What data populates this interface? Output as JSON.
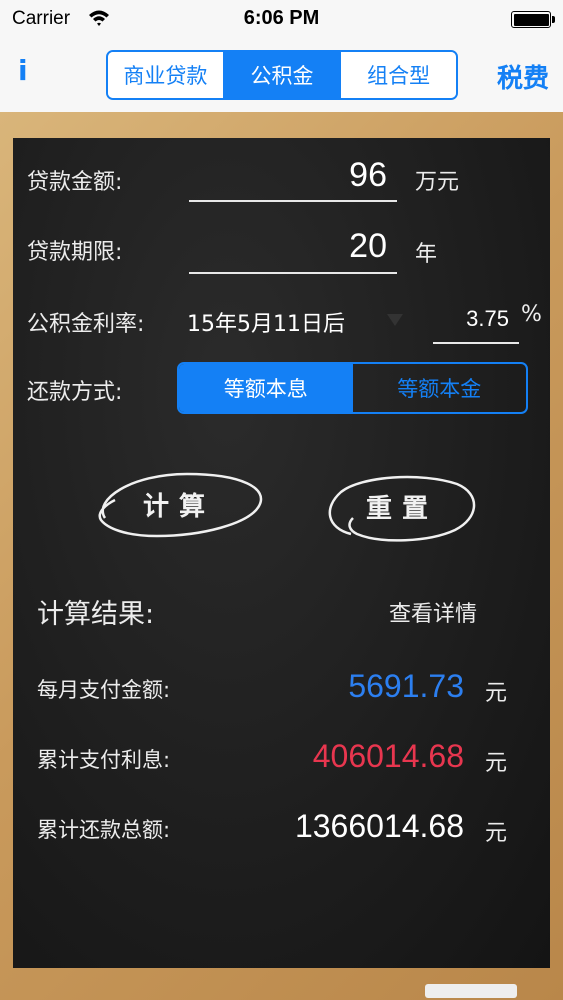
{
  "status_bar": {
    "carrier": "Carrier",
    "time": "6:06 PM"
  },
  "nav": {
    "info_label": "i",
    "segments": [
      {
        "label": "商业贷款",
        "active": false
      },
      {
        "label": "公积金",
        "active": true
      },
      {
        "label": "组合型",
        "active": false
      }
    ],
    "tax_label": "税费"
  },
  "form": {
    "amount": {
      "label": "贷款金额:",
      "value": "96",
      "unit": "万元"
    },
    "term": {
      "label": "贷款期限:",
      "value": "20",
      "unit": "年"
    },
    "rate": {
      "label": "公积金利率:",
      "selected": "15年5月11日后",
      "value": "3.75",
      "unit": "%"
    },
    "method": {
      "label": "还款方式:",
      "options": [
        "等额本息",
        "等额本金"
      ],
      "selected_index": 0
    }
  },
  "actions": {
    "calculate": "计算",
    "reset": "重置"
  },
  "result": {
    "title": "计算结果:",
    "detail_link": "查看详情",
    "rows": [
      {
        "label": "每月支付金额:",
        "value": "5691.73",
        "unit": "元",
        "color": "#2c7ff0"
      },
      {
        "label": "累计支付利息:",
        "value": "406014.68",
        "unit": "元",
        "color": "#e8364f"
      },
      {
        "label": "累计还款总额:",
        "value": "1366014.68",
        "unit": "元",
        "color": "#ffffff"
      }
    ]
  },
  "colors": {
    "accent": "#1480f5",
    "board": "#1d1d1d",
    "frame": "#c99a5c"
  }
}
